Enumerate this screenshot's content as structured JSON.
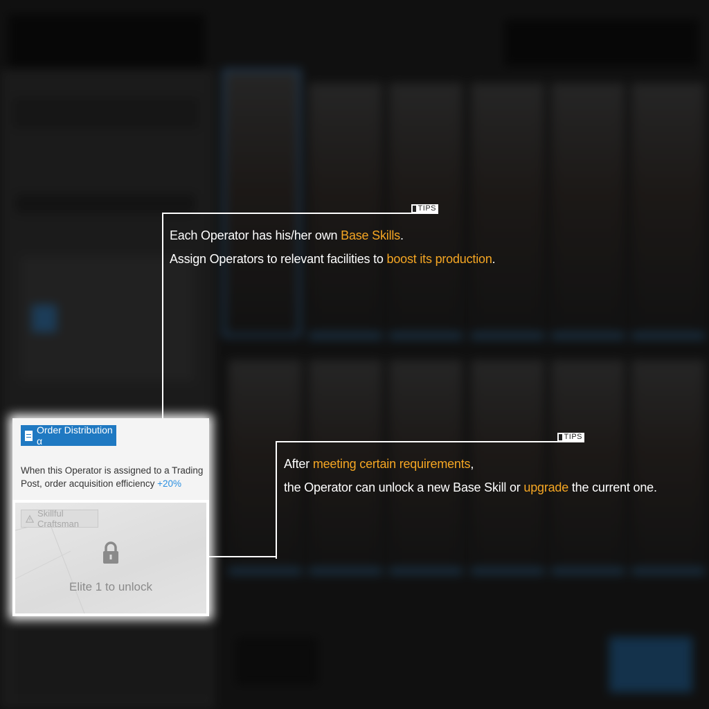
{
  "skill_panel": {
    "skill_1": {
      "name": "Order Distribution α",
      "description": "When this Operator is assigned to a Trading Post, order acquisition efficiency ",
      "bonus": "+20%"
    },
    "skill_2": {
      "name": "Skillful Craftsman",
      "unlock_condition": "Elite 1 to unlock"
    }
  },
  "tips": [
    {
      "tag": "TIPS",
      "line1": {
        "a": "Each Operator has his/her own ",
        "hl": "Base Skills",
        "b": "."
      },
      "line2": {
        "a": "Assign Operators to relevant facilities to ",
        "hl": "boost its production",
        "b": "."
      }
    },
    {
      "tag": "TIPS",
      "line1": {
        "a": "After ",
        "hl": "meeting certain requirements",
        "b": ","
      },
      "line2": {
        "a": "the Operator can unlock a new Base Skill or ",
        "hl": "upgrade",
        "b": " the current one."
      }
    }
  ],
  "colors": {
    "highlight": "#f5a623",
    "skill_header": "#1f79c2",
    "bonus": "#2a8fe0"
  },
  "icons": [
    "document-icon",
    "warning-triangle-icon",
    "lock-icon"
  ]
}
